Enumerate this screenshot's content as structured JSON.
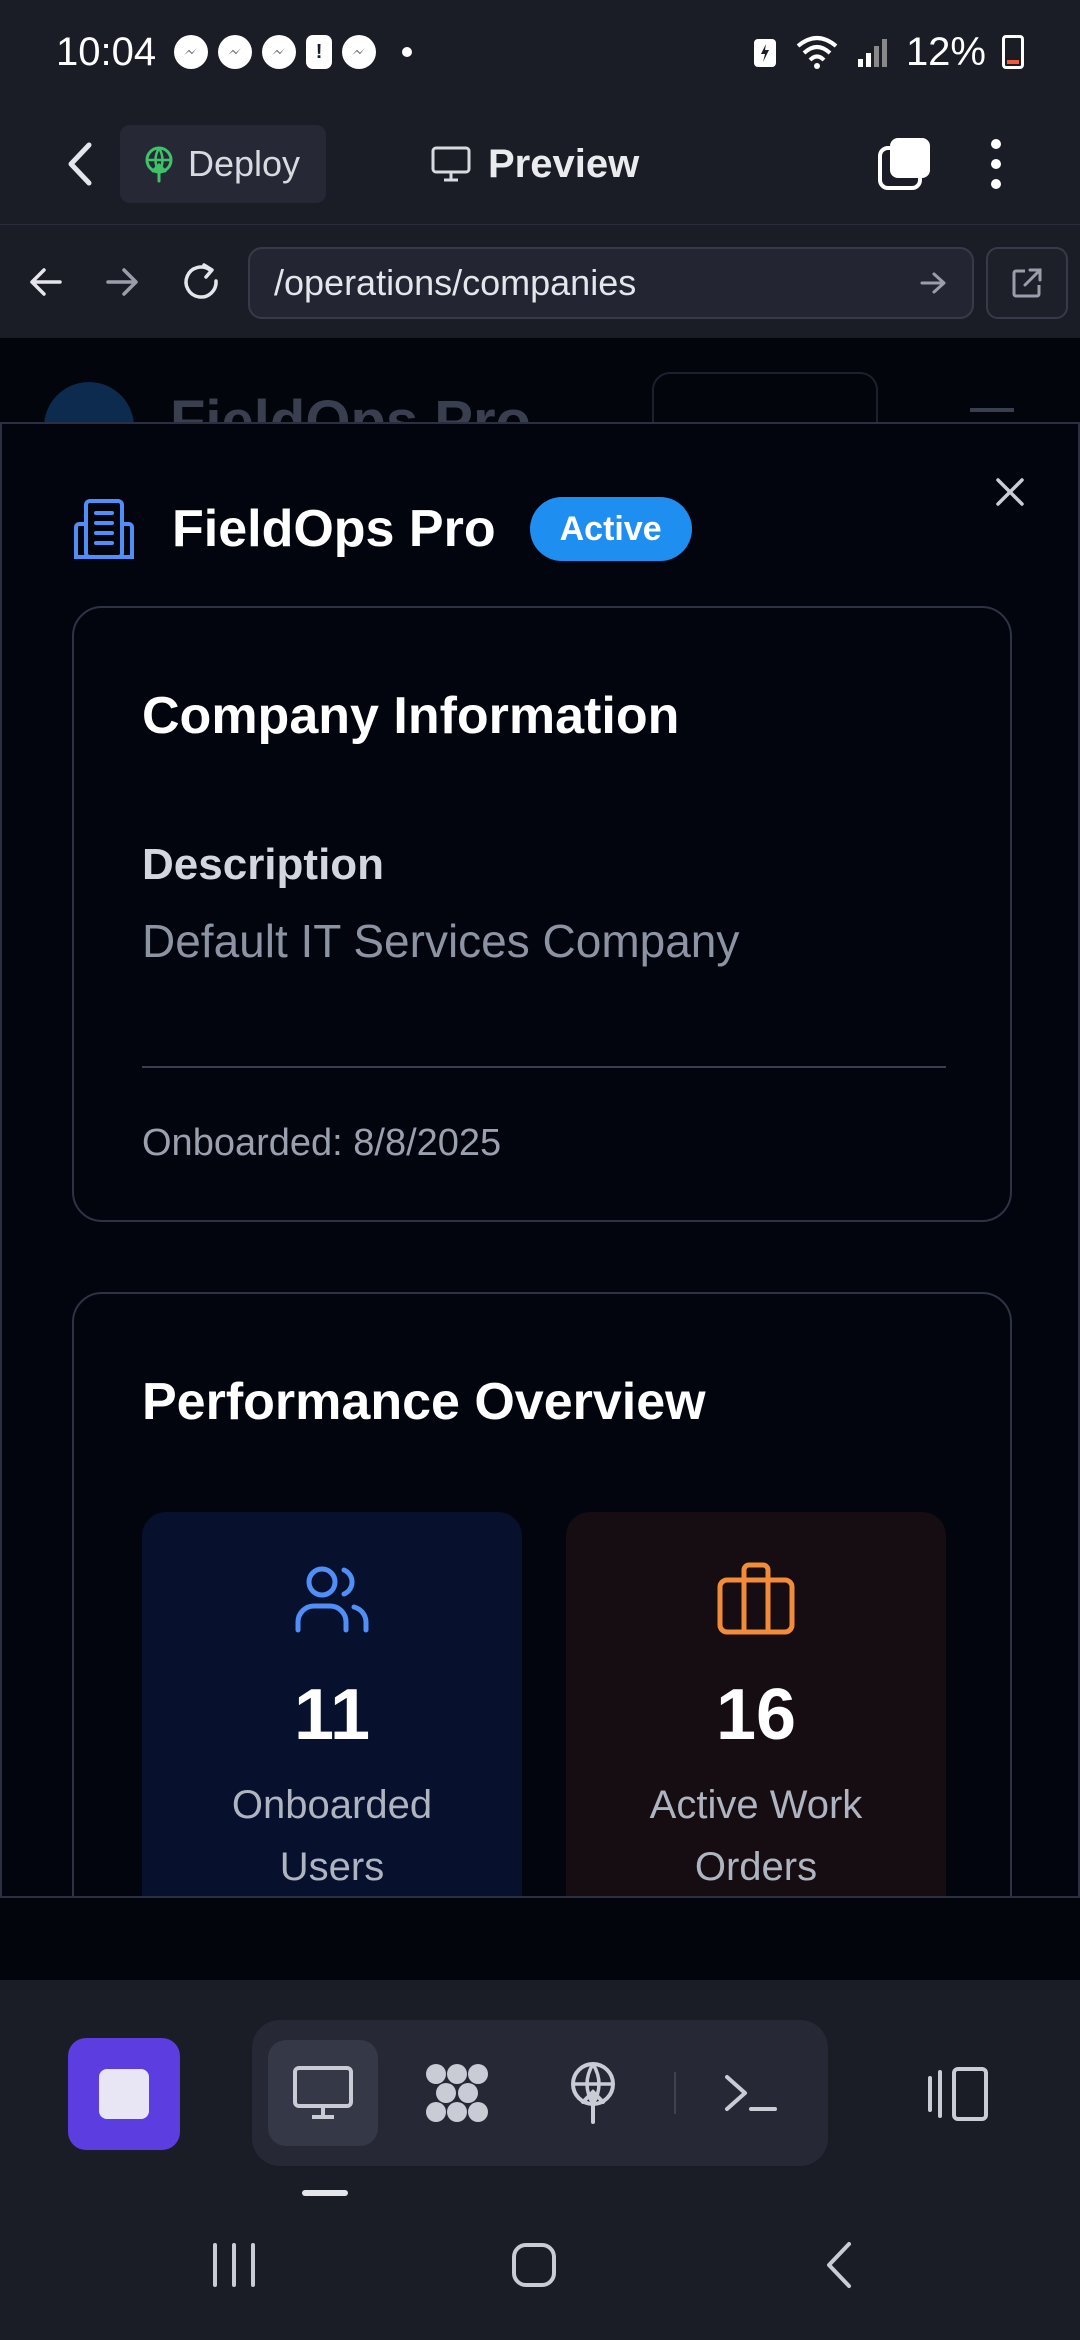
{
  "status_bar": {
    "time": "10:04",
    "battery": "12%",
    "notification_icons": [
      "messenger-icon",
      "messenger-icon",
      "messenger-icon",
      "alert-icon",
      "messenger-icon"
    ]
  },
  "app_toolbar": {
    "deploy_label": "Deploy",
    "preview_label": "Preview"
  },
  "url_bar": {
    "url": "/operations/companies"
  },
  "background_page": {
    "title": "FieldOps Pro"
  },
  "modal": {
    "title": "FieldOps Pro",
    "status": "Active",
    "company_info": {
      "heading": "Company Information",
      "description_label": "Description",
      "description_value": "Default IT Services Company",
      "onboarded": "Onboarded: 8/8/2025"
    },
    "performance": {
      "heading": "Performance Overview",
      "stats": [
        {
          "value": "11",
          "label": "Onboarded Users",
          "icon": "users-icon",
          "color": "#4f8ff7"
        },
        {
          "value": "16",
          "label": "Active Work Orders",
          "icon": "briefcase-icon",
          "color": "#f28c38"
        }
      ]
    }
  },
  "colors": {
    "badge": "#1f8ef1",
    "accent_purple": "#5b3de0"
  }
}
